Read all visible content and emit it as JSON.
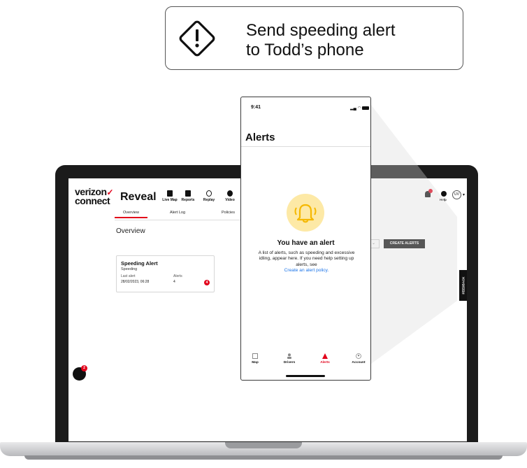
{
  "callout": {
    "line1": "Send speeding alert",
    "line2": "to Todd’s phone",
    "icon": "warning-icon"
  },
  "app": {
    "logo_top": "verizon",
    "logo_bottom": "connect",
    "name": "Reveal",
    "nav": [
      {
        "label": "Live Map",
        "icon": "map-icon"
      },
      {
        "label": "Reports",
        "icon": "report-icon"
      },
      {
        "label": "Replay",
        "icon": "replay-icon"
      },
      {
        "label": "Video",
        "icon": "video-icon"
      }
    ],
    "subtabs": [
      "Overview",
      "Alert Log",
      "Policies"
    ],
    "active_subtab": "Overview",
    "page_heading": "Overview",
    "create_alerts_label": "CREATE ALERTS",
    "feedback_label": "FEEDBACK",
    "help_label": "Help",
    "avatar_initials": "UV",
    "chat_badge": "2",
    "accent_color": "#e2001a"
  },
  "alert_card": {
    "title": "Speeding Alert",
    "subtitle": "Speeding",
    "last_alert_label": "Last alert",
    "last_alert_value": "28/02/2023, 06:28",
    "alerts_label": "Alerts",
    "alerts_value": "4",
    "badge_value": "4"
  },
  "phone": {
    "time": "9:41",
    "title": "Alerts",
    "empty_heading": "You have an alert",
    "empty_body": "A list of alerts, such as speeding and excessive idling, appear here. If you need help setting up alerts, see",
    "empty_link": "Create an alert policy.",
    "tabs": [
      {
        "label": "Map",
        "icon": "map-icon"
      },
      {
        "label": "Drivers",
        "icon": "driver-icon"
      },
      {
        "label": "Alerts",
        "icon": "alert-icon"
      },
      {
        "label": "Account",
        "icon": "account-icon"
      }
    ],
    "active_tab": "Alerts",
    "bell_bg_color": "#fde9a6",
    "bell_color": "#f5b800"
  }
}
